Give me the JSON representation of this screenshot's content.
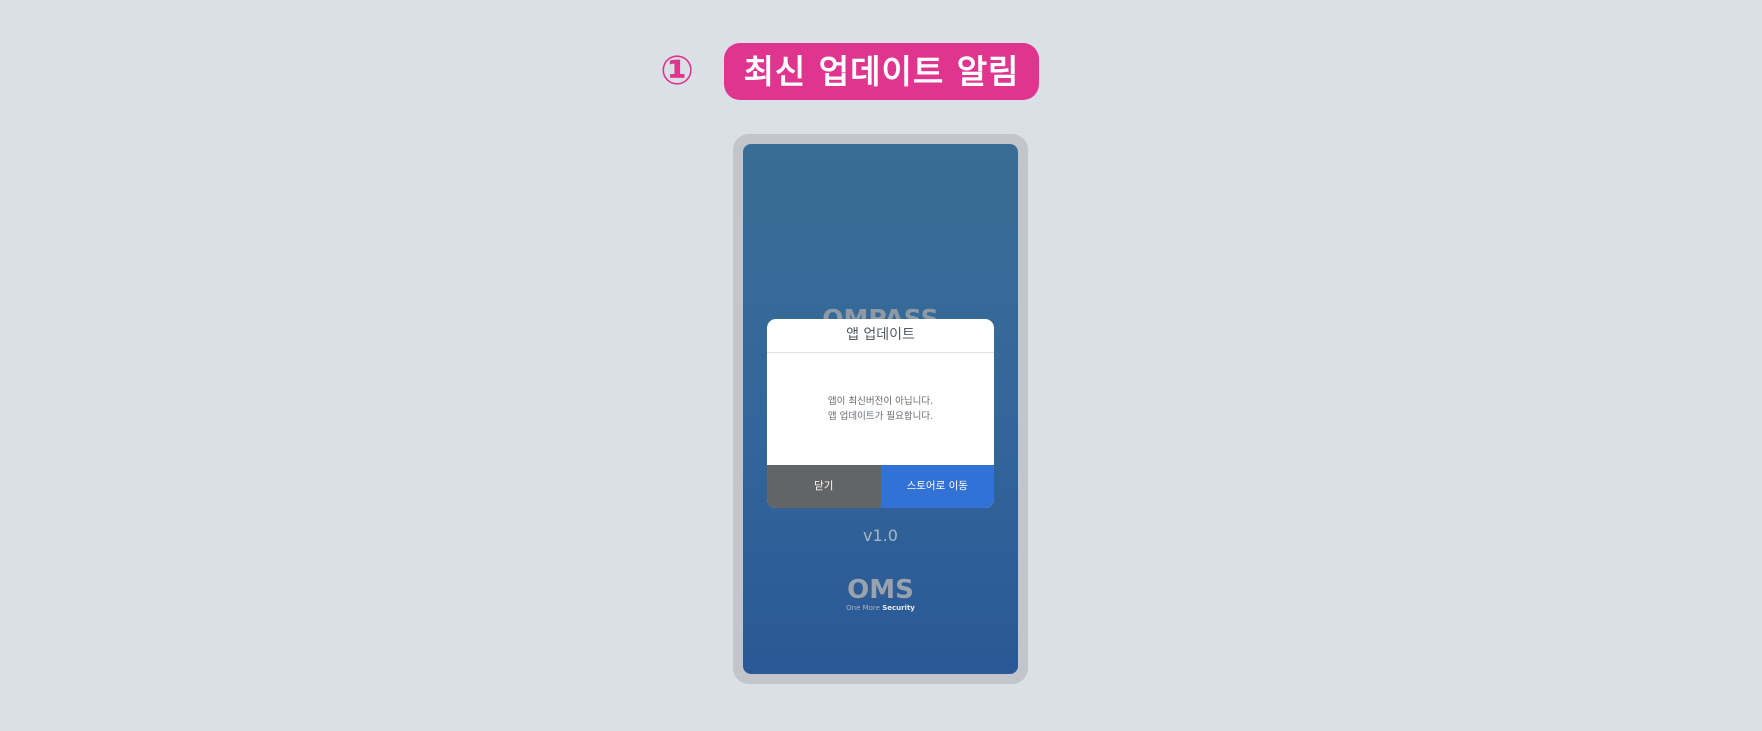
{
  "header": {
    "step_number": "①",
    "title": "최신 업데이트 알림"
  },
  "app": {
    "logo_text": "OMPASS",
    "version": "v1.0",
    "company": {
      "name": "OMS",
      "tagline_prefix": "One More ",
      "tagline_bold": "Security"
    }
  },
  "dialog": {
    "title": "앱 업데이트",
    "message_lines": [
      "앱이 최신버전이 아닙니다.",
      "앱 업데이트가 필요합니다."
    ],
    "buttons": {
      "close": "닫기",
      "store": "스토어로 이동"
    }
  },
  "colors": {
    "accent": "#e0358f",
    "background": "#dae0e6",
    "screen_gradient_top": "#396d95",
    "screen_gradient_bottom": "#2a5896",
    "close_button": "#636466",
    "store_button": "#3272d6"
  }
}
